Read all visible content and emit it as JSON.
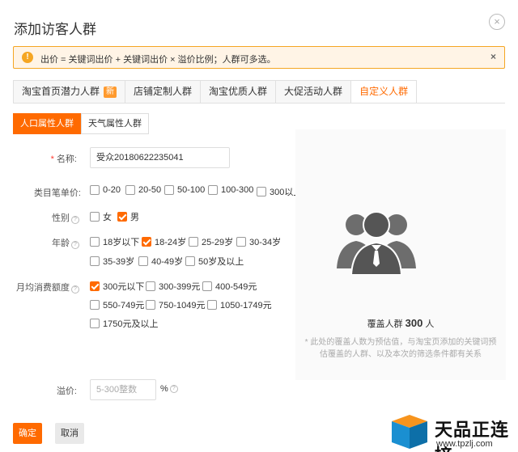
{
  "dialog": {
    "title": "添加访客人群",
    "close_icon": "close-circle-icon"
  },
  "alert": {
    "text": "出价 = 关键词出价 + 关键词出价 × 溢价比例；人群可多选。",
    "icon": "!",
    "close": "×",
    "color": "#f5a623"
  },
  "tabs": [
    {
      "label": "淘宝首页潜力人群",
      "badge": "新"
    },
    {
      "label": "店铺定制人群"
    },
    {
      "label": "淘宝优质人群"
    },
    {
      "label": "大促活动人群"
    },
    {
      "label": "自定义人群",
      "active": true
    }
  ],
  "subtabs": [
    {
      "label": "人口属性人群",
      "active": true
    },
    {
      "label": "天气属性人群"
    }
  ],
  "form": {
    "name": {
      "label": "名称:",
      "required_mark": "*",
      "value": "受众20180622235041"
    },
    "price": {
      "label": "类目笔单价:",
      "options": [
        {
          "label": "0-20",
          "checked": false
        },
        {
          "label": "20-50",
          "checked": false
        },
        {
          "label": "50-100",
          "checked": false
        },
        {
          "label": "100-300",
          "checked": false
        },
        {
          "label": "300以上",
          "checked": false
        }
      ]
    },
    "gender": {
      "label": "性别",
      "options": [
        {
          "label": "女",
          "checked": false
        },
        {
          "label": "男",
          "checked": true
        }
      ]
    },
    "age": {
      "label": "年龄",
      "options": [
        {
          "label": "18岁以下",
          "checked": false
        },
        {
          "label": "18-24岁",
          "checked": true
        },
        {
          "label": "25-29岁",
          "checked": false
        },
        {
          "label": "30-34岁",
          "checked": false
        },
        {
          "label": "35-39岁",
          "checked": false
        },
        {
          "label": "40-49岁",
          "checked": false
        },
        {
          "label": "50岁及以上",
          "checked": false
        }
      ]
    },
    "spend": {
      "label": "月均消费额度",
      "options": [
        {
          "label": "300元以下",
          "checked": true
        },
        {
          "label": "300-399元",
          "checked": false
        },
        {
          "label": "400-549元",
          "checked": false
        },
        {
          "label": "550-749元",
          "checked": false
        },
        {
          "label": "750-1049元",
          "checked": false
        },
        {
          "label": "1050-1749元",
          "checked": false
        },
        {
          "label": "1750元及以上",
          "checked": false
        }
      ]
    },
    "premium": {
      "label": "溢价:",
      "placeholder": "5-300整数",
      "unit": "%"
    },
    "help_icon": "?"
  },
  "side": {
    "icon": "audience-group-icon",
    "coverage_prefix": "覆盖人群",
    "coverage_value": "300",
    "coverage_unit": "人",
    "note": "* 此处的覆盖人数为预估值，与淘宝页添加的关键词预估覆盖的人群、以及本次的筛选条件都有关系"
  },
  "buttons": {
    "ok": "确定",
    "cancel": "取消"
  },
  "watermark": {
    "name": "天品正连接",
    "url": "www.tpzlj.com"
  },
  "colors": {
    "accent": "#ff6a00",
    "warning": "#f5a623"
  }
}
